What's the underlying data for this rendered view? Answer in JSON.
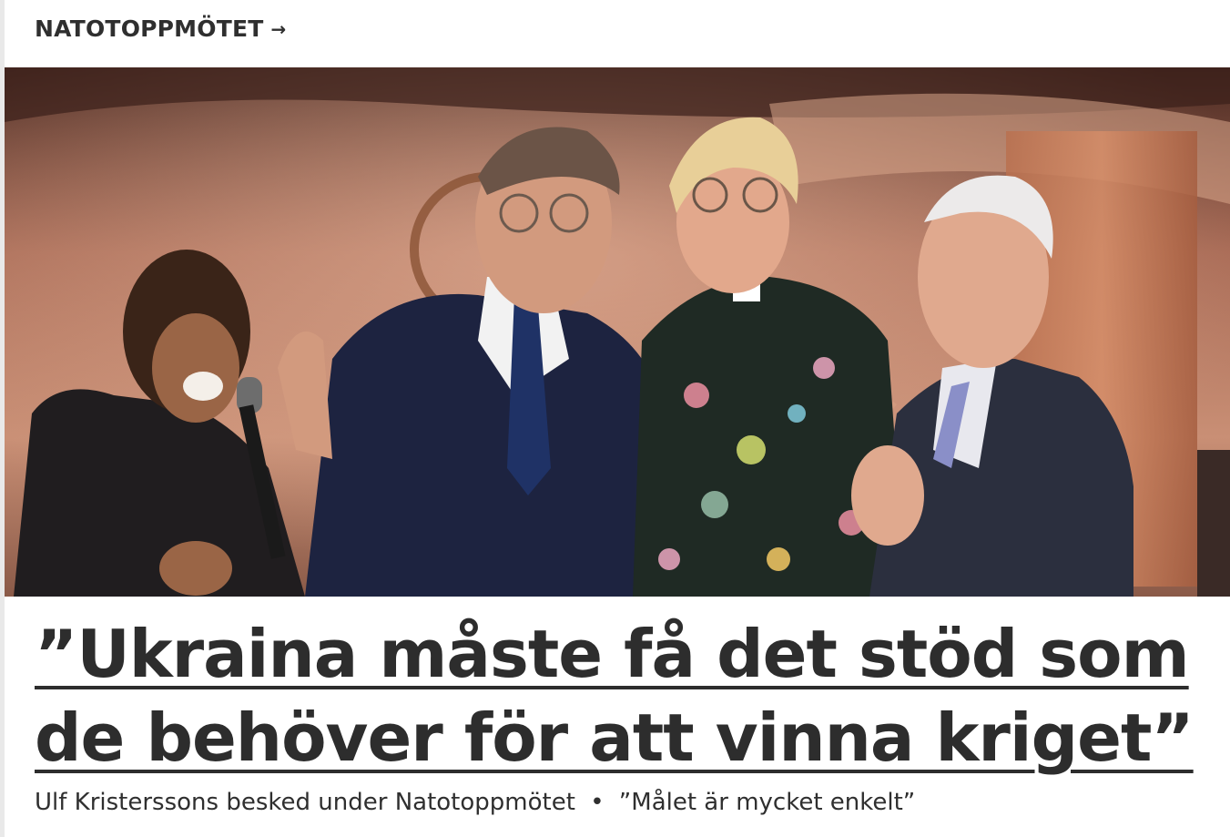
{
  "header": {
    "kicker_label": "NATOTOPPMÖTET",
    "kicker_arrow": "→"
  },
  "hero_image": {
    "description_icon": "photo-collage"
  },
  "article": {
    "headline_line1": "”Ukraina måste få det stöd som",
    "headline_line2": "de behöver för att vinna kriget”",
    "summary_part1": "Ulf Kristerssons besked under Natotoppmötet",
    "separator": "•",
    "summary_part2": "”Målet är mycket enkelt”"
  },
  "colors": {
    "text": "#2d2d2d",
    "background": "#ffffff"
  }
}
